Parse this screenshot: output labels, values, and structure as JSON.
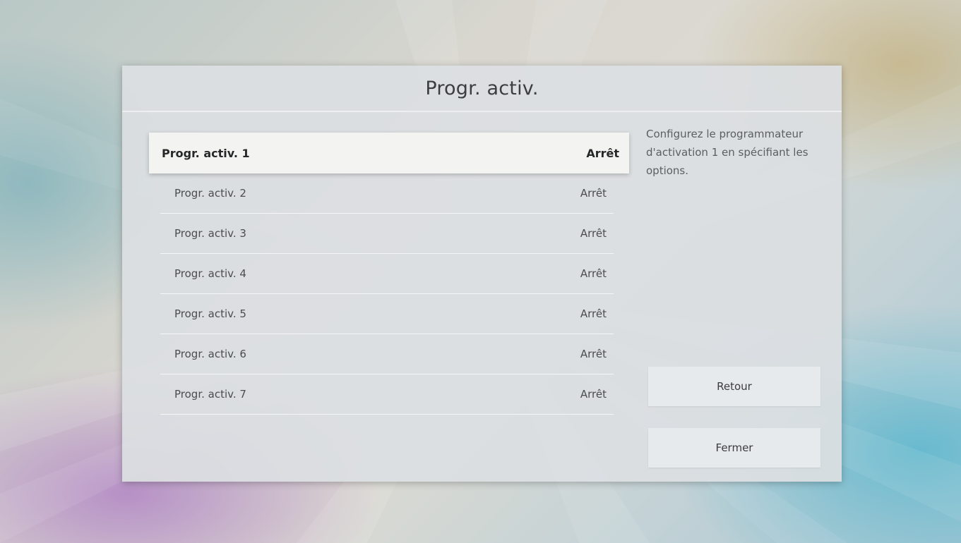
{
  "dialog": {
    "title": "Progr. activ.",
    "description": "Configurez le programmateur d'activation 1 en spécifiant les options."
  },
  "list": {
    "items": [
      {
        "label": "Progr. activ. 1",
        "value": "Arrêt",
        "selected": true
      },
      {
        "label": "Progr. activ. 2",
        "value": "Arrêt",
        "selected": false
      },
      {
        "label": "Progr. activ. 3",
        "value": "Arrêt",
        "selected": false
      },
      {
        "label": "Progr. activ. 4",
        "value": "Arrêt",
        "selected": false
      },
      {
        "label": "Progr. activ. 5",
        "value": "Arrêt",
        "selected": false
      },
      {
        "label": "Progr. activ. 6",
        "value": "Arrêt",
        "selected": false
      },
      {
        "label": "Progr. activ. 7",
        "value": "Arrêt",
        "selected": false
      }
    ]
  },
  "buttons": {
    "back_label": "Retour",
    "close_label": "Fermer"
  },
  "colors": {
    "selected_row_bg": "#f3f3f2",
    "dialog_bg": "#dcdfe2",
    "text_primary": "#262729",
    "text_secondary": "#4a4c50"
  }
}
